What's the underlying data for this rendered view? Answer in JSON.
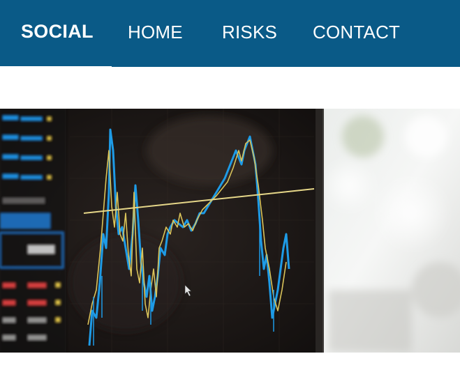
{
  "navbar": {
    "brand": "SOCIAL",
    "links": [
      "HOME",
      "RISKS",
      "CONTACT"
    ]
  },
  "hero": {
    "image": "trading-chart-monitor-photo"
  },
  "colors": {
    "nav_background": "#0a5a87",
    "nav_text": "#ffffff",
    "page_background": "#ffffff",
    "chart_blue": "#1e9be6",
    "chart_gold": "#d9c35a"
  }
}
